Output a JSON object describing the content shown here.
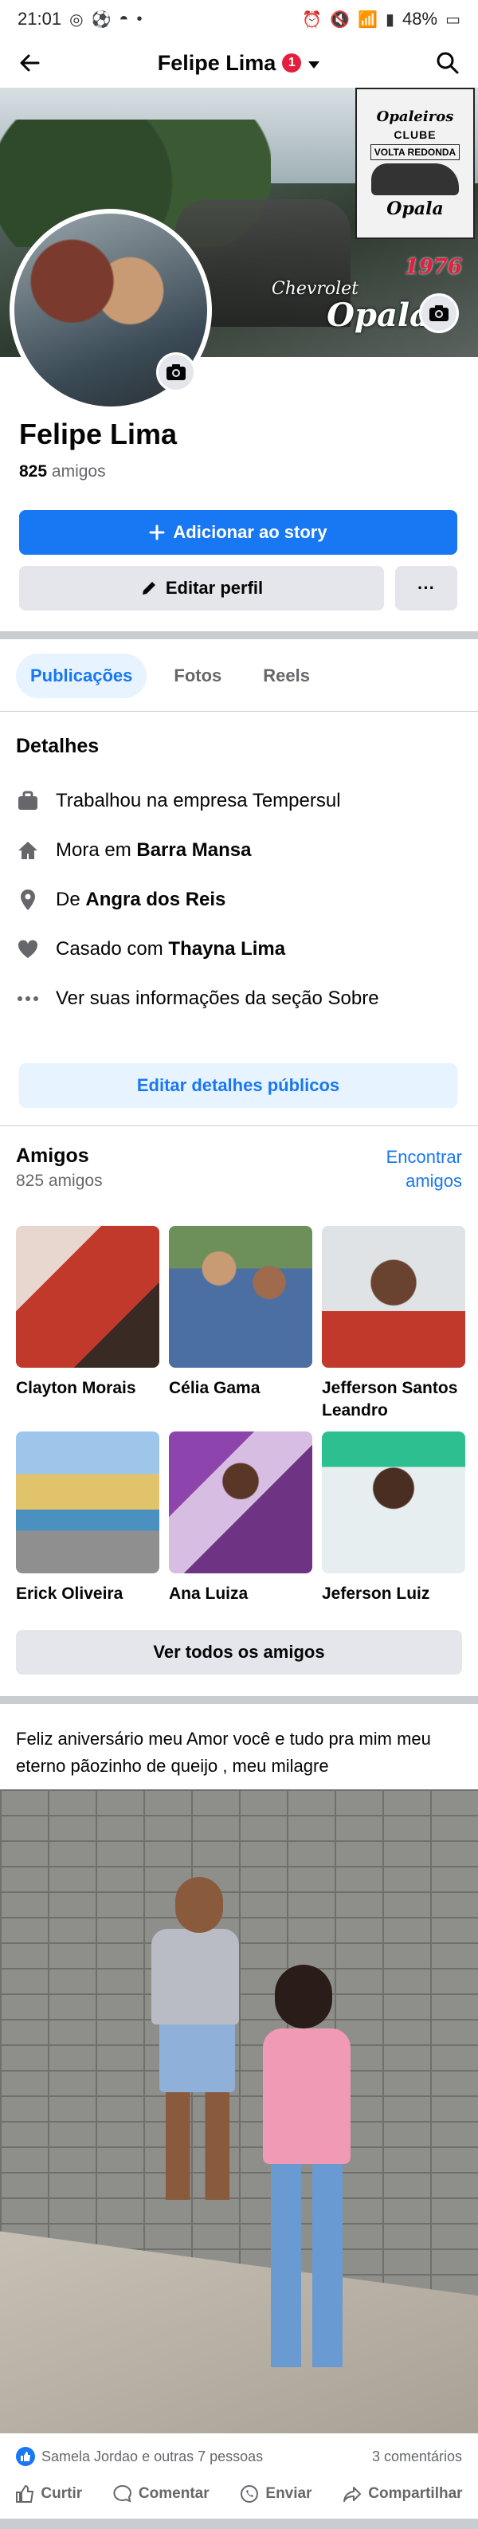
{
  "status_bar": {
    "time": "21:01",
    "battery": "48%"
  },
  "header": {
    "title": "Felipe Lima",
    "notification_count": "1"
  },
  "cover": {
    "logo_title": "Opaleiros",
    "logo_clube": "CLUBE",
    "logo_city": "VOLTA REDONDA",
    "logo_opala": "Opala",
    "chevrolet_text": "Chevrolet",
    "year_text": "1976",
    "opala_big": "Opala"
  },
  "profile": {
    "name": "Felipe Lima",
    "friends_count": "825",
    "friends_label": "amigos",
    "add_story": "Adicionar ao story",
    "edit_profile": "Editar perfil",
    "more": "···"
  },
  "tabs": [
    {
      "label": "Publicações"
    },
    {
      "label": "Fotos"
    },
    {
      "label": "Reels"
    }
  ],
  "details": {
    "title": "Detalhes",
    "work": "Trabalhou na empresa Tempersul",
    "lives_prefix": "Mora em",
    "lives_city": "Barra Mansa",
    "from_prefix": "De",
    "from_city": "Angra dos Reis",
    "married_prefix": "Casado com",
    "married_name": "Thayna Lima",
    "about": "Ver suas informações da seção Sobre",
    "edit_button": "Editar detalhes públicos"
  },
  "friends": {
    "title": "Amigos",
    "count": "825 amigos",
    "find": "Encontrar amigos",
    "list": [
      {
        "name": "Clayton Morais"
      },
      {
        "name": "Célia Gama"
      },
      {
        "name": "Jefferson Santos Leandro"
      },
      {
        "name": "Erick Oliveira"
      },
      {
        "name": "Ana Luiza"
      },
      {
        "name": "Jeferson Luiz"
      }
    ],
    "see_all": "Ver todos os amigos"
  },
  "post": {
    "text": "Feliz aniversário meu Amor você e tudo pra mim meu eterno pãozinho de queijo , meu milagre",
    "reactions": "Samela Jordao e outras 7 pessoas",
    "comments": "3 comentários",
    "actions": {
      "like": "Curtir",
      "comment": "Comentar",
      "send": "Enviar",
      "share": "Compartilhar"
    }
  },
  "colors": {
    "accent": "#1877f2",
    "badge": "#e41e3f",
    "secondary_bg": "#e4e6eb"
  }
}
